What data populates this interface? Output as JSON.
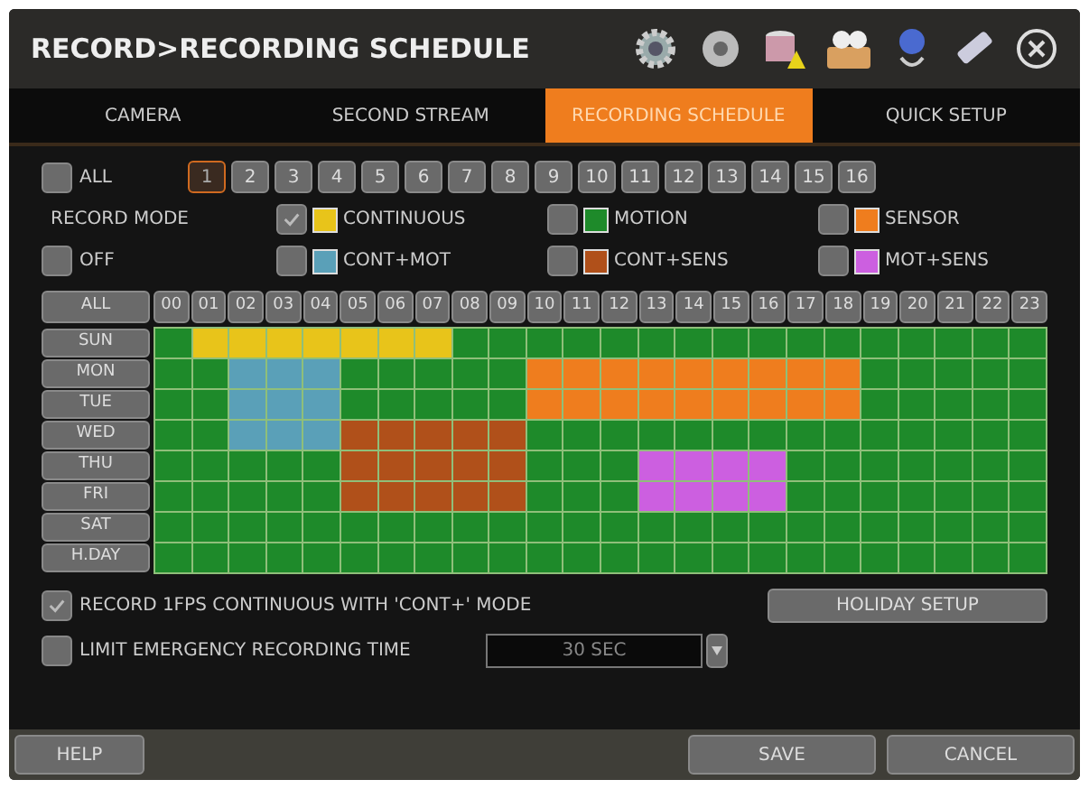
{
  "window": {
    "title": "RECORD>RECORDING SCHEDULE"
  },
  "tabs": [
    {
      "label": "CAMERA",
      "selected": false
    },
    {
      "label": "SECOND STREAM",
      "selected": false
    },
    {
      "label": "RECORDING SCHEDULE",
      "selected": true
    },
    {
      "label": "QUICK SETUP",
      "selected": false
    }
  ],
  "camera_all": {
    "label": "ALL",
    "checked": false
  },
  "cameras": [
    {
      "label": "1",
      "selected": true
    },
    {
      "label": "2",
      "selected": false
    },
    {
      "label": "3",
      "selected": false
    },
    {
      "label": "4",
      "selected": false
    },
    {
      "label": "5",
      "selected": false
    },
    {
      "label": "6",
      "selected": false
    },
    {
      "label": "7",
      "selected": false
    },
    {
      "label": "8",
      "selected": false
    },
    {
      "label": "9",
      "selected": false
    },
    {
      "label": "10",
      "selected": false
    },
    {
      "label": "11",
      "selected": false
    },
    {
      "label": "12",
      "selected": false
    },
    {
      "label": "13",
      "selected": false
    },
    {
      "label": "14",
      "selected": false
    },
    {
      "label": "15",
      "selected": false
    },
    {
      "label": "16",
      "selected": false
    }
  ],
  "record_mode": {
    "label": "RECORD MODE",
    "off": {
      "label": "OFF",
      "checked": false
    },
    "modes": [
      {
        "label": "CONTINUOUS",
        "color": "#e8c41a",
        "checked": true
      },
      {
        "label": "MOTION",
        "color": "#1e8a2a",
        "checked": false
      },
      {
        "label": "SENSOR",
        "color": "#ef7d1e",
        "checked": false
      },
      {
        "label": "CONT+MOT",
        "color": "#5aa0b8",
        "checked": false
      },
      {
        "label": "CONT+SENS",
        "color": "#b0501a",
        "checked": false
      },
      {
        "label": "MOT+SENS",
        "color": "#cc5fe0",
        "checked": false
      }
    ]
  },
  "schedule": {
    "all_button": "ALL",
    "hours": [
      "00",
      "01",
      "02",
      "03",
      "04",
      "05",
      "06",
      "07",
      "08",
      "09",
      "10",
      "11",
      "12",
      "13",
      "14",
      "15",
      "16",
      "17",
      "18",
      "19",
      "20",
      "21",
      "22",
      "23"
    ],
    "rows": [
      {
        "day": "SUN",
        "cells": [
          {
            "color": "#1e8a2a"
          },
          {
            "color": "#e8c41a"
          },
          {
            "color": "#e8c41a"
          },
          {
            "color": "#e8c41a"
          },
          {
            "color": "#e8c41a"
          },
          {
            "color": "#e8c41a"
          },
          {
            "color": "#e8c41a"
          },
          {
            "color": "#e8c41a"
          },
          {
            "color": "#1e8a2a"
          },
          {
            "color": "#1e8a2a"
          },
          {
            "color": "#1e8a2a"
          },
          {
            "color": "#1e8a2a"
          },
          {
            "color": "#1e8a2a"
          },
          {
            "color": "#1e8a2a"
          },
          {
            "color": "#1e8a2a"
          },
          {
            "color": "#1e8a2a"
          },
          {
            "color": "#1e8a2a"
          },
          {
            "color": "#1e8a2a"
          },
          {
            "color": "#1e8a2a"
          },
          {
            "color": "#1e8a2a"
          },
          {
            "color": "#1e8a2a"
          },
          {
            "color": "#1e8a2a"
          },
          {
            "color": "#1e8a2a"
          },
          {
            "color": "#1e8a2a"
          }
        ]
      },
      {
        "day": "MON",
        "cells": [
          {
            "color": "#1e8a2a"
          },
          {
            "color": "#1e8a2a"
          },
          {
            "color": "#5aa0b8"
          },
          {
            "color": "#5aa0b8"
          },
          {
            "color": "#5aa0b8"
          },
          {
            "color": "#1e8a2a"
          },
          {
            "color": "#1e8a2a"
          },
          {
            "color": "#1e8a2a"
          },
          {
            "color": "#1e8a2a"
          },
          {
            "color": "#1e8a2a"
          },
          {
            "color": "#ef7d1e"
          },
          {
            "color": "#ef7d1e"
          },
          {
            "color": "#ef7d1e"
          },
          {
            "color": "#ef7d1e"
          },
          {
            "color": "#ef7d1e"
          },
          {
            "color": "#ef7d1e"
          },
          {
            "color": "#ef7d1e"
          },
          {
            "color": "#ef7d1e"
          },
          {
            "color": "#ef7d1e"
          },
          {
            "color": "#1e8a2a"
          },
          {
            "color": "#1e8a2a"
          },
          {
            "color": "#1e8a2a"
          },
          {
            "color": "#1e8a2a"
          },
          {
            "color": "#1e8a2a"
          }
        ]
      },
      {
        "day": "TUE",
        "cells": [
          {
            "color": "#1e8a2a"
          },
          {
            "color": "#1e8a2a"
          },
          {
            "color": "#5aa0b8"
          },
          {
            "color": "#5aa0b8"
          },
          {
            "color": "#5aa0b8"
          },
          {
            "color": "#1e8a2a"
          },
          {
            "color": "#1e8a2a"
          },
          {
            "color": "#1e8a2a"
          },
          {
            "color": "#1e8a2a"
          },
          {
            "color": "#1e8a2a"
          },
          {
            "color": "#ef7d1e"
          },
          {
            "color": "#ef7d1e"
          },
          {
            "color": "#ef7d1e"
          },
          {
            "color": "#ef7d1e"
          },
          {
            "color": "#ef7d1e"
          },
          {
            "color": "#ef7d1e"
          },
          {
            "color": "#ef7d1e"
          },
          {
            "color": "#ef7d1e"
          },
          {
            "color": "#ef7d1e"
          },
          {
            "color": "#1e8a2a"
          },
          {
            "color": "#1e8a2a"
          },
          {
            "color": "#1e8a2a"
          },
          {
            "color": "#1e8a2a"
          },
          {
            "color": "#1e8a2a"
          }
        ]
      },
      {
        "day": "WED",
        "cells": [
          {
            "color": "#1e8a2a"
          },
          {
            "color": "#1e8a2a"
          },
          {
            "color": "#5aa0b8"
          },
          {
            "color": "#5aa0b8"
          },
          {
            "color": "#5aa0b8"
          },
          {
            "color": "#b0501a"
          },
          {
            "color": "#b0501a"
          },
          {
            "color": "#b0501a"
          },
          {
            "color": "#b0501a"
          },
          {
            "color": "#b0501a"
          },
          {
            "color": "#1e8a2a"
          },
          {
            "color": "#1e8a2a"
          },
          {
            "color": "#1e8a2a"
          },
          {
            "color": "#1e8a2a"
          },
          {
            "color": "#1e8a2a"
          },
          {
            "color": "#1e8a2a"
          },
          {
            "color": "#1e8a2a"
          },
          {
            "color": "#1e8a2a"
          },
          {
            "color": "#1e8a2a"
          },
          {
            "color": "#1e8a2a"
          },
          {
            "color": "#1e8a2a"
          },
          {
            "color": "#1e8a2a"
          },
          {
            "color": "#1e8a2a"
          },
          {
            "color": "#1e8a2a"
          }
        ]
      },
      {
        "day": "THU",
        "cells": [
          {
            "color": "#1e8a2a"
          },
          {
            "color": "#1e8a2a"
          },
          {
            "color": "#1e8a2a"
          },
          {
            "color": "#1e8a2a"
          },
          {
            "color": "#1e8a2a"
          },
          {
            "color": "#b0501a"
          },
          {
            "color": "#b0501a"
          },
          {
            "color": "#b0501a"
          },
          {
            "color": "#b0501a"
          },
          {
            "color": "#b0501a"
          },
          {
            "color": "#1e8a2a"
          },
          {
            "color": "#1e8a2a"
          },
          {
            "color": "#1e8a2a"
          },
          {
            "color": "#cc5fe0"
          },
          {
            "color": "#cc5fe0"
          },
          {
            "color": "#cc5fe0"
          },
          {
            "color": "#cc5fe0"
          },
          {
            "color": "#1e8a2a"
          },
          {
            "color": "#1e8a2a"
          },
          {
            "color": "#1e8a2a"
          },
          {
            "color": "#1e8a2a"
          },
          {
            "color": "#1e8a2a"
          },
          {
            "color": "#1e8a2a"
          },
          {
            "color": "#1e8a2a"
          }
        ]
      },
      {
        "day": "FRI",
        "cells": [
          {
            "color": "#1e8a2a"
          },
          {
            "color": "#1e8a2a"
          },
          {
            "color": "#1e8a2a"
          },
          {
            "color": "#1e8a2a"
          },
          {
            "color": "#1e8a2a"
          },
          {
            "color": "#b0501a"
          },
          {
            "color": "#b0501a"
          },
          {
            "color": "#b0501a"
          },
          {
            "color": "#b0501a"
          },
          {
            "color": "#b0501a"
          },
          {
            "color": "#1e8a2a"
          },
          {
            "color": "#1e8a2a"
          },
          {
            "color": "#1e8a2a"
          },
          {
            "color": "#cc5fe0"
          },
          {
            "color": "#cc5fe0"
          },
          {
            "color": "#cc5fe0"
          },
          {
            "color": "#cc5fe0"
          },
          {
            "color": "#1e8a2a"
          },
          {
            "color": "#1e8a2a"
          },
          {
            "color": "#1e8a2a"
          },
          {
            "color": "#1e8a2a"
          },
          {
            "color": "#1e8a2a"
          },
          {
            "color": "#1e8a2a"
          },
          {
            "color": "#1e8a2a"
          }
        ]
      },
      {
        "day": "SAT",
        "cells": [
          {
            "color": "#1e8a2a"
          },
          {
            "color": "#1e8a2a"
          },
          {
            "color": "#1e8a2a"
          },
          {
            "color": "#1e8a2a"
          },
          {
            "color": "#1e8a2a"
          },
          {
            "color": "#1e8a2a"
          },
          {
            "color": "#1e8a2a"
          },
          {
            "color": "#1e8a2a"
          },
          {
            "color": "#1e8a2a"
          },
          {
            "color": "#1e8a2a"
          },
          {
            "color": "#1e8a2a"
          },
          {
            "color": "#1e8a2a"
          },
          {
            "color": "#1e8a2a"
          },
          {
            "color": "#1e8a2a"
          },
          {
            "color": "#1e8a2a"
          },
          {
            "color": "#1e8a2a"
          },
          {
            "color": "#1e8a2a"
          },
          {
            "color": "#1e8a2a"
          },
          {
            "color": "#1e8a2a"
          },
          {
            "color": "#1e8a2a"
          },
          {
            "color": "#1e8a2a"
          },
          {
            "color": "#1e8a2a"
          },
          {
            "color": "#1e8a2a"
          },
          {
            "color": "#1e8a2a"
          }
        ]
      },
      {
        "day": "H.DAY",
        "cells": [
          {
            "color": "#1e8a2a"
          },
          {
            "color": "#1e8a2a"
          },
          {
            "color": "#1e8a2a"
          },
          {
            "color": "#1e8a2a"
          },
          {
            "color": "#1e8a2a"
          },
          {
            "color": "#1e8a2a"
          },
          {
            "color": "#1e8a2a"
          },
          {
            "color": "#1e8a2a"
          },
          {
            "color": "#1e8a2a"
          },
          {
            "color": "#1e8a2a"
          },
          {
            "color": "#1e8a2a"
          },
          {
            "color": "#1e8a2a"
          },
          {
            "color": "#1e8a2a"
          },
          {
            "color": "#1e8a2a"
          },
          {
            "color": "#1e8a2a"
          },
          {
            "color": "#1e8a2a"
          },
          {
            "color": "#1e8a2a"
          },
          {
            "color": "#1e8a2a"
          },
          {
            "color": "#1e8a2a"
          },
          {
            "color": "#1e8a2a"
          },
          {
            "color": "#1e8a2a"
          },
          {
            "color": "#1e8a2a"
          },
          {
            "color": "#1e8a2a"
          },
          {
            "color": "#1e8a2a"
          }
        ]
      }
    ]
  },
  "options": {
    "record_1fps": {
      "label": "RECORD 1FPS CONTINUOUS WITH 'CONT+' MODE",
      "checked": true
    },
    "holiday_button": "HOLIDAY SETUP",
    "limit_emergency": {
      "label": "LIMIT EMERGENCY RECORDING TIME",
      "checked": false,
      "value": "30 SEC"
    }
  },
  "buttons": {
    "help": "HELP",
    "save": "SAVE",
    "cancel": "CANCEL"
  }
}
